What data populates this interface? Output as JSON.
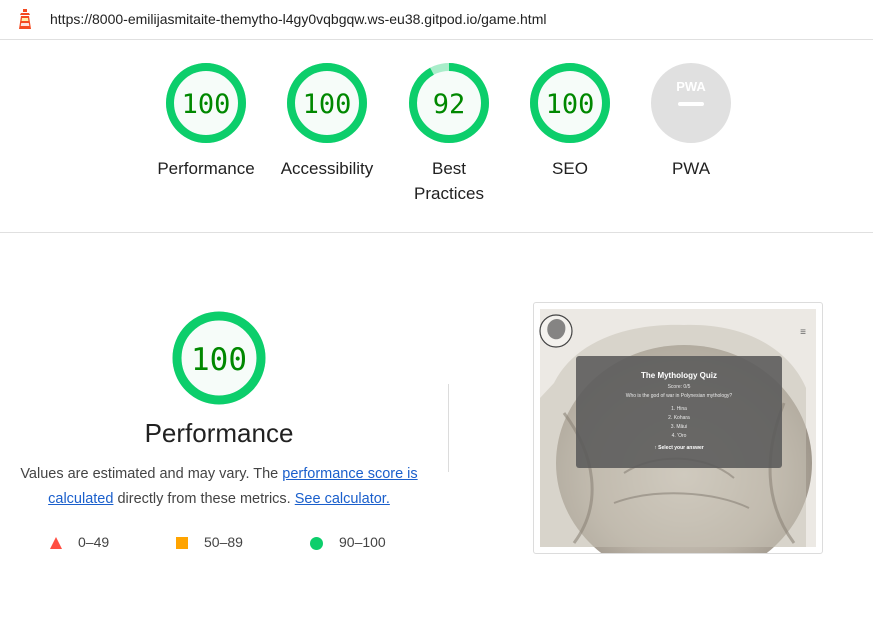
{
  "header": {
    "url": "https://8000-emilijasmitaite-themytho-l4gy0vqbgqw.ws-eu38.gitpod.io/game.html"
  },
  "gauges": [
    {
      "score": "100",
      "label": "Performance",
      "value": 100
    },
    {
      "score": "100",
      "label": "Accessibility",
      "value": 100
    },
    {
      "score": "92",
      "label": "Best Practices",
      "value": 92
    },
    {
      "score": "100",
      "label": "SEO",
      "value": 100
    },
    {
      "score": "",
      "label": "PWA",
      "badge": "PWA"
    }
  ],
  "performance": {
    "score": "100",
    "value": 100,
    "title": "Performance",
    "desc_text1": "Values are estimated and may vary. The ",
    "desc_link1": "performance score is calculated",
    "desc_text2": " directly from these metrics. ",
    "desc_link2": "See calculator."
  },
  "legend": {
    "fail": "0–49",
    "average": "50–89",
    "pass": "90–100"
  },
  "preview": {
    "title": "The Mythology Quiz",
    "score": "Score: 0/5",
    "question": "Who is the god of war in Polynesian mythology?",
    "options": [
      "1. Hina",
      "2. Kohara",
      "3. Māui",
      "4. 'Oro"
    ],
    "prompt": "↑ Select your answer",
    "menu_icon": "≡"
  },
  "colors": {
    "pass": "#0cce6b",
    "pass_text": "#008800",
    "pass_fill": "#e6f9ee",
    "average": "#ffa400",
    "fail": "#ff4e42",
    "pwa_gray": "#e0e0e0"
  }
}
